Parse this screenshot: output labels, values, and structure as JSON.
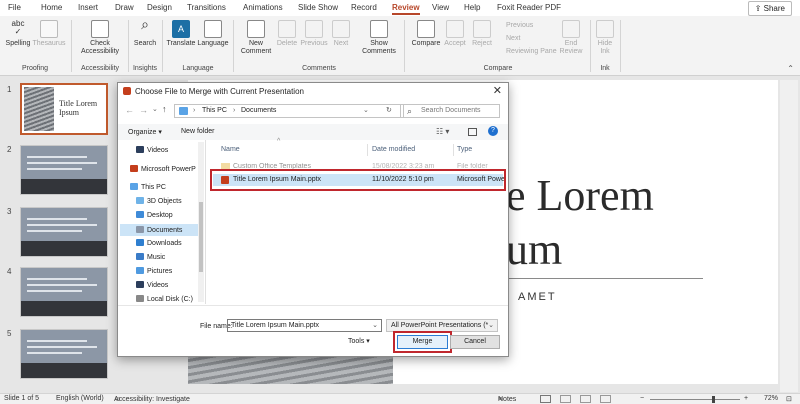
{
  "tabs": [
    "File",
    "Home",
    "Insert",
    "Draw",
    "Design",
    "Transitions",
    "Animations",
    "Slide Show",
    "Record",
    "Review",
    "View",
    "Help",
    "Foxit Reader PDF"
  ],
  "share_label": "Share",
  "ribbon": {
    "spelling": "Spelling",
    "thesaurus": "Thesaurus",
    "check_access": "Check Accessibility",
    "search": "Search",
    "translate": "Translate",
    "language": "Language",
    "new_comment": "New Comment",
    "delete": "Delete",
    "previous": "Previous",
    "next": "Next",
    "show_comments": "Show Comments",
    "compare": "Compare",
    "accept": "Accept",
    "reject": "Reject",
    "prev_small": "Previous",
    "next_small": "Next",
    "reviewing_pane": "Reviewing Pane",
    "end_review": "End Review",
    "hide_ink": "Hide Ink",
    "groups": {
      "proofing": "Proofing",
      "accessibility": "Accessibility",
      "insights": "Insights",
      "language": "Language",
      "comments": "Comments",
      "compare": "Compare",
      "ink": "Ink"
    }
  },
  "thumbnails": {
    "slide1_title": "Title Lorem Ipsum",
    "numbers": [
      "1",
      "2",
      "3",
      "4",
      "5"
    ]
  },
  "slide": {
    "title_line1": "e Lorem",
    "title_line2": "um",
    "subtitle": "AMET"
  },
  "dialog": {
    "title": "Choose File to Merge with Current Presentation",
    "breadcrumb_root": "This PC",
    "breadcrumb_leaf": "Documents",
    "search_placeholder": "Search Documents",
    "organize": "Organize",
    "new_folder": "New folder",
    "nav": [
      "Videos",
      "Microsoft PowerP",
      "This PC",
      "3D Objects",
      "Desktop",
      "Documents",
      "Downloads",
      "Music",
      "Pictures",
      "Videos",
      "Local Disk (C:)"
    ],
    "columns": {
      "name": "Name",
      "date": "Date modified",
      "type": "Type"
    },
    "files": [
      {
        "name": "Custom Office Templates",
        "date": "15/08/2022 3:23 am",
        "type": "File folder"
      },
      {
        "name": "Title Lorem Ipsum Main.pptx",
        "date": "11/10/2022 5:10 pm",
        "type": "Microsoft Powe"
      }
    ],
    "file_name_label": "File name:",
    "file_name_value": "Title Lorem Ipsum Main.pptx",
    "file_type_value": "All PowerPoint Presentations (*",
    "tools": "Tools",
    "merge": "Merge",
    "cancel": "Cancel"
  },
  "status": {
    "slide_of": "Slide 1 of 5",
    "language": "English (World)",
    "accessibility": "Accessibility: Investigate",
    "notes": "Notes",
    "zoom": "72%"
  },
  "colors": {
    "accent": "#b7472a",
    "highlight": "#c0272d",
    "selection": "#cce4f7"
  }
}
